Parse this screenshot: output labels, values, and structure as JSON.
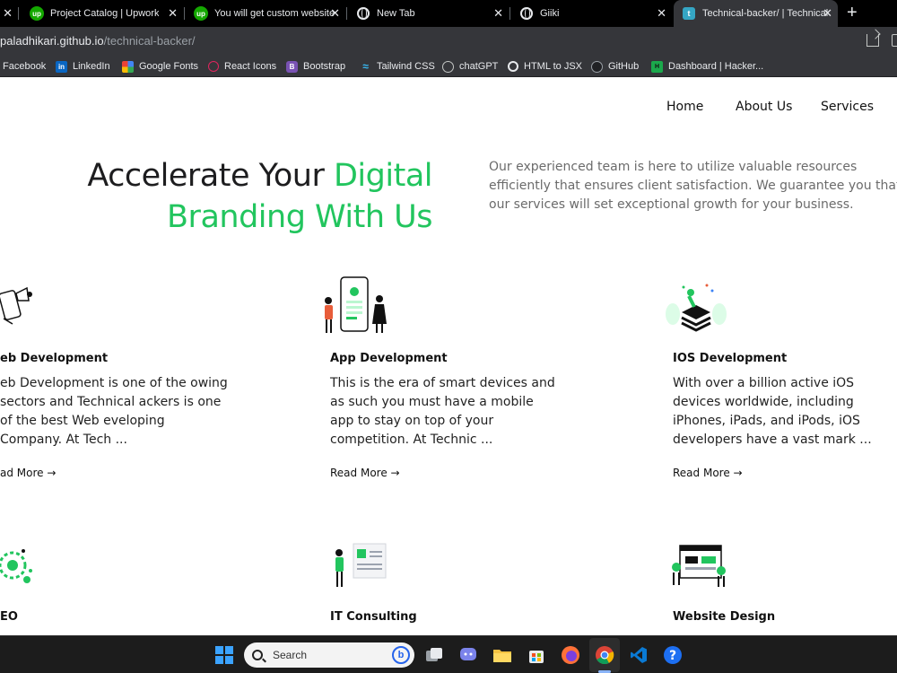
{
  "browser": {
    "tabs": [
      {
        "title": "",
        "favicon": "tab-fragment",
        "active": false
      },
      {
        "title": "Project Catalog | Upwork",
        "favicon": "upwork-icon",
        "active": false
      },
      {
        "title": "You will get custom website",
        "favicon": "upwork-icon",
        "active": false
      },
      {
        "title": "New Tab",
        "favicon": "globe-icon",
        "active": false
      },
      {
        "title": "Giiki",
        "favicon": "globe-icon",
        "active": false
      },
      {
        "title": "Technical-backer/ | Technical",
        "favicon": "site-icon",
        "active": true
      }
    ],
    "close_glyph": "✕",
    "new_tab_glyph": "+",
    "url_host": "paladhikari.github.io",
    "url_path": "/technical-backer/",
    "bookmarks": [
      {
        "label": "Facebook",
        "icon": "facebook-icon"
      },
      {
        "label": "LinkedIn",
        "icon": "linkedin-icon"
      },
      {
        "label": "Google Fonts",
        "icon": "google-fonts-icon"
      },
      {
        "label": "React Icons",
        "icon": "react-icon"
      },
      {
        "label": "Bootstrap",
        "icon": "bootstrap-icon"
      },
      {
        "label": "Tailwind CSS",
        "icon": "tailwind-icon"
      },
      {
        "label": "chatGPT",
        "icon": "openai-icon"
      },
      {
        "label": "HTML to JSX",
        "icon": "globe-icon"
      },
      {
        "label": "GitHub",
        "icon": "github-icon"
      },
      {
        "label": "Dashboard | Hacker...",
        "icon": "hackerrank-icon"
      }
    ]
  },
  "site": {
    "nav": [
      "Home",
      "About Us",
      "Services"
    ],
    "hero": {
      "title_dark": "Accelerate Your ",
      "title_green_1": "Digital",
      "title_green_2": "Branding With Us",
      "description": "Our experienced team is here to utilize valuable resources efficiently that ensures client satisfaction. We guarantee you that our services will set exceptional growth for your business."
    },
    "services": [
      {
        "title": "eb Development",
        "desc": "eb Development is one of the owing sectors and Technical ackers is one of the best Web eveloping Company. At Tech ...",
        "more": "ad More →"
      },
      {
        "title": "App Development",
        "desc": "This is the era of smart devices and as such you must have a mobile app to stay on top of your competition. At Technic ...",
        "more": "Read More →"
      },
      {
        "title": "IOS Development",
        "desc": "With over a billion active iOS devices worldwide, including iPhones, iPads, and iPods, iOS developers have a vast mark ...",
        "more": "Read More →"
      },
      {
        "title": "EO",
        "desc": "",
        "more": ""
      },
      {
        "title": "IT Consulting",
        "desc": "",
        "more": ""
      },
      {
        "title": "Website Design",
        "desc": "",
        "more": ""
      }
    ],
    "accent_color": "#22c55e"
  },
  "taskbar": {
    "search_placeholder": "Search",
    "apps": [
      "windows-start-icon",
      "task-view-icon",
      "chat-icon",
      "file-explorer-icon",
      "store-icon",
      "firefox-icon",
      "chrome-icon",
      "vscode-icon",
      "help-icon"
    ]
  }
}
